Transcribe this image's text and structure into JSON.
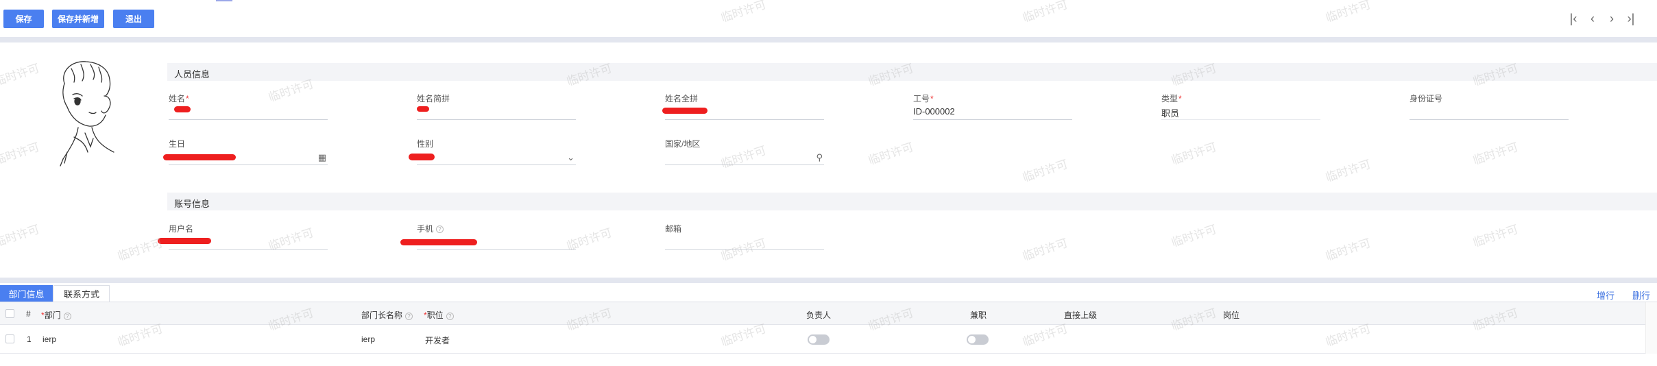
{
  "toolbar": {
    "save": "保存",
    "save_new": "保存并新增",
    "exit": "退出"
  },
  "pager": {
    "first": "|<",
    "prev": "<",
    "next": ">",
    "last": ">|"
  },
  "person_section": {
    "title": "人员信息",
    "fields": {
      "name": {
        "label": "姓名",
        "value": ""
      },
      "name_short": {
        "label": "姓名简拼",
        "value": ""
      },
      "name_full": {
        "label": "姓名全拼",
        "value": ""
      },
      "emp_no": {
        "label": "工号",
        "value": "ID-000002"
      },
      "type": {
        "label": "类型",
        "value": "职员"
      },
      "id_card": {
        "label": "身份证号",
        "value": ""
      },
      "birthday": {
        "label": "生日",
        "value": ""
      },
      "gender": {
        "label": "性别",
        "value": ""
      },
      "country": {
        "label": "国家/地区",
        "value": ""
      }
    }
  },
  "account_section": {
    "title": "账号信息",
    "fields": {
      "username": {
        "label": "用户名",
        "value": ""
      },
      "phone": {
        "label": "手机",
        "value": ""
      },
      "email": {
        "label": "邮箱",
        "value": ""
      }
    }
  },
  "tabs": {
    "dept": "部门信息",
    "contact": "联系方式"
  },
  "row_actions": {
    "add": "增行",
    "delete": "删行"
  },
  "table": {
    "headers": {
      "index": "#",
      "dept": "部门",
      "dept_head_name": "部门长名称",
      "position": "职位",
      "leader": "负责人",
      "part_time": "兼职",
      "direct_superior": "直接上级",
      "post": "岗位"
    },
    "rows": [
      {
        "index": "1",
        "dept": "ierp",
        "dept_head_name": "ierp",
        "position": "开发者",
        "leader": false,
        "part_time": false,
        "direct_superior": "",
        "post": ""
      }
    ]
  },
  "watermark": "临时许可",
  "colors": {
    "primary": "#4a7ff0",
    "required": "#e33333",
    "band": "#e3e6ef"
  }
}
